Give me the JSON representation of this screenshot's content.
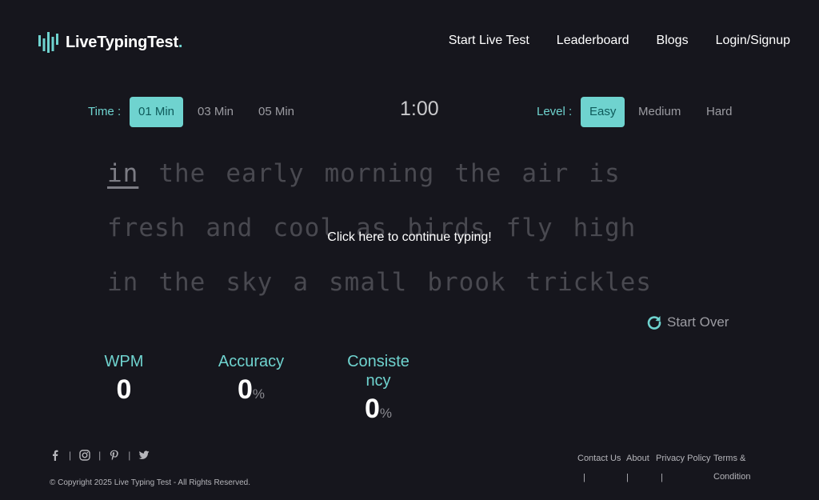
{
  "header": {
    "logo_text": "LiveTypingTest",
    "logo_dot": ".",
    "nav": [
      "Start Live Test",
      "Leaderboard",
      "Blogs",
      "Login/Signup"
    ]
  },
  "controls": {
    "time_label": "Time :",
    "time_options": [
      "01 Min",
      "03 Min",
      "05 Min"
    ],
    "time_selected": "01 Min",
    "timer": "1:00",
    "level_label": "Level :",
    "level_options": [
      "Easy",
      "Medium",
      "Hard"
    ],
    "level_selected": "Easy"
  },
  "typing": {
    "lines": [
      [
        "in",
        "the",
        "early",
        "morning",
        "the",
        "air",
        "is"
      ],
      [
        "fresh",
        "and",
        "cool",
        "as",
        "birds",
        "fly",
        "high"
      ],
      [
        "in",
        "the",
        "sky",
        "a",
        "small",
        "brook",
        "trickles"
      ]
    ],
    "current_word": "in",
    "overlay_message": "Click here to continue typing!"
  },
  "start_over_label": "Start Over",
  "stats": {
    "wpm_label": "WPM",
    "wpm_value": "0",
    "accuracy_label": "Accuracy",
    "accuracy_value": "0",
    "accuracy_unit": "%",
    "consistency_label_line1": "Consiste",
    "consistency_label_line2": "ncy",
    "consistency_value": "0",
    "consistency_unit": "%"
  },
  "footer": {
    "social_icons": [
      "facebook-icon",
      "instagram-icon",
      "pinterest-icon",
      "twitter-icon"
    ],
    "separator": "|",
    "copyright": "© Copyright 2025 Live Typing Test - All Rights Reserved.",
    "links": [
      "Contact Us",
      "About",
      "Privacy Policy",
      "Terms &",
      "Condition"
    ]
  },
  "colors": {
    "background": "#16161d",
    "accent": "#6fd3cf",
    "text_dim": "#494950"
  }
}
